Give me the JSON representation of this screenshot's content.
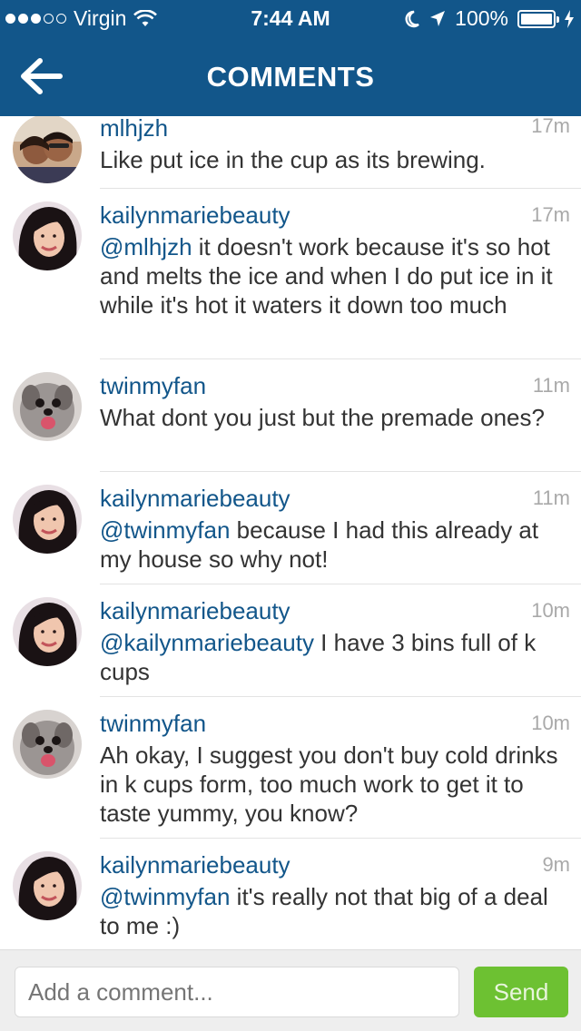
{
  "status_bar": {
    "carrier": "Virgin",
    "time": "7:44 AM",
    "battery": "100%"
  },
  "header": {
    "title": "COMMENTS"
  },
  "comments": [
    {
      "username": "mlhjzh",
      "time": "17m",
      "mention": "",
      "text": "Like put ice in the cup as its brewing."
    },
    {
      "username": "kailynmariebeauty",
      "time": "17m",
      "mention": "@mlhjzh",
      "text": " it doesn't work because it's so hot and melts the ice and when I do put ice in it while it's hot it waters it down too much"
    },
    {
      "username": "twinmyfan",
      "time": "11m",
      "mention": "",
      "text": "What dont you just but the premade ones?"
    },
    {
      "username": "kailynmariebeauty",
      "time": "11m",
      "mention": "@twinmyfan",
      "text": " because I had this already at my house so why not!"
    },
    {
      "username": "kailynmariebeauty",
      "time": "10m",
      "mention": "@kailynmariebeauty",
      "text": " I have 3 bins full of k cups"
    },
    {
      "username": "twinmyfan",
      "time": "10m",
      "mention": "",
      "text": "Ah okay, I suggest you don't buy cold drinks in k cups form, too much work to get it to taste yummy, you know?"
    },
    {
      "username": "kailynmariebeauty",
      "time": "9m",
      "mention": "@twinmyfan",
      "text": " it's really not that big of a deal to me :)"
    }
  ],
  "composer": {
    "placeholder": "Add a comment...",
    "send_label": "Send"
  },
  "colors": {
    "brand": "#12568a",
    "send": "#6dc132"
  }
}
